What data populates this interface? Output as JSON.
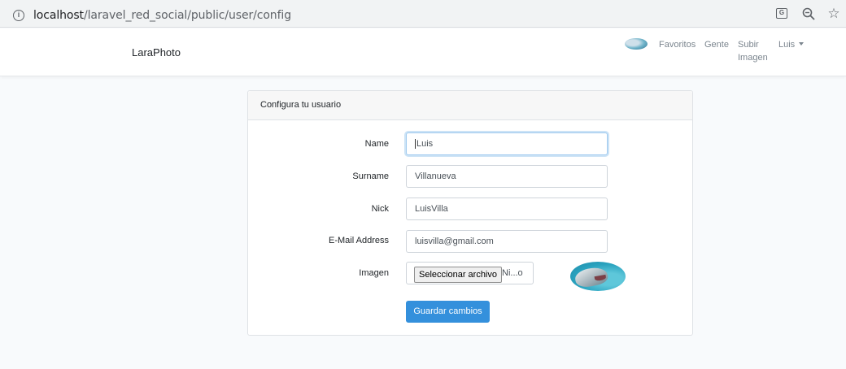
{
  "browser": {
    "url_host": "localhost",
    "url_path": "/laravel_red_social/public/user/config"
  },
  "navbar": {
    "brand": "LaraPhoto",
    "links": {
      "favoritos": "Favoritos",
      "gente": "Gente",
      "subir_imagen": "Subir Imagen",
      "user": "Luis"
    }
  },
  "card": {
    "header": "Configura tu usuario",
    "fields": {
      "name": {
        "label": "Name",
        "value": "Luis"
      },
      "surname": {
        "label": "Surname",
        "value": "Villanueva"
      },
      "nick": {
        "label": "Nick",
        "value": "LuisVilla"
      },
      "email": {
        "label": "E-Mail Address",
        "value": "luisvilla@gmail.com"
      },
      "image": {
        "label": "Imagen",
        "button": "Seleccionar archivo",
        "filename": "Ni...o"
      }
    },
    "submit": "Guardar cambios"
  },
  "icons": {
    "info": "info-icon",
    "translate": "translate-icon",
    "zoom": "zoom-icon",
    "bookmark": "star-icon"
  },
  "colors": {
    "primary": "#3490dc",
    "background": "#f8fafc"
  }
}
